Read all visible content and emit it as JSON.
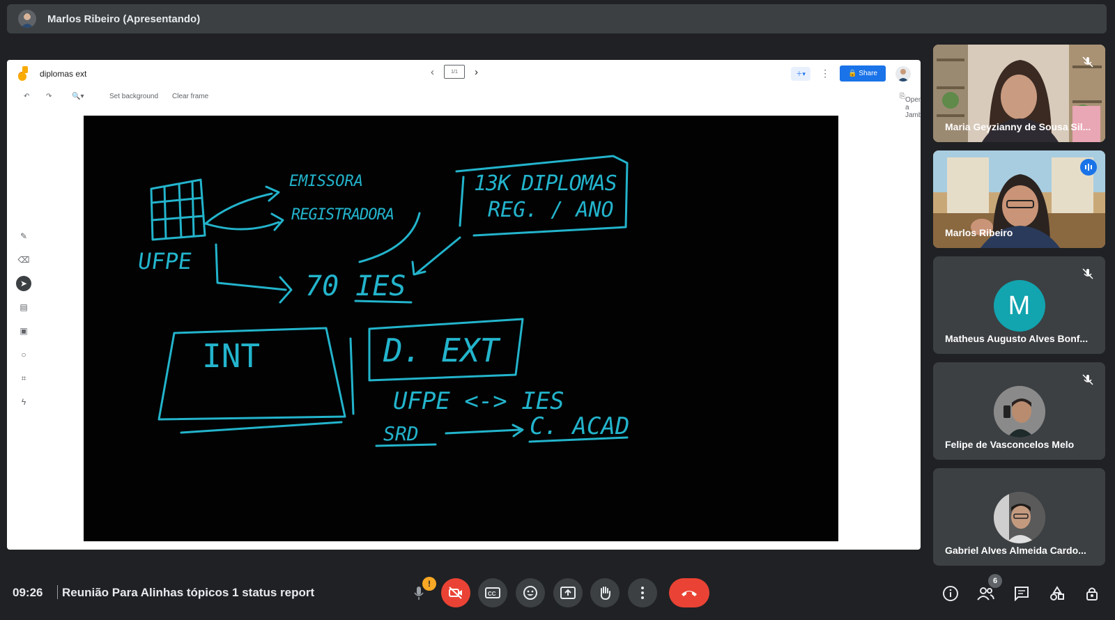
{
  "presenter": {
    "name": "Marlos Ribeiro (Apresentando)"
  },
  "jamboard": {
    "title": "diplomas ext",
    "frame_indicator": "1/1",
    "share_label": "Share",
    "toolbar": {
      "set_background": "Set background",
      "clear_frame": "Clear frame",
      "open_label": "Open on a Jamboard"
    },
    "accent": "#1a73e8"
  },
  "participants": [
    {
      "name": "Maria Geyzianny de Sousa Sil...",
      "muted": true,
      "type": "video"
    },
    {
      "name": "Marlos Ribeiro",
      "speaking": true,
      "type": "video"
    },
    {
      "name": "Matheus Augusto Alves Bonf...",
      "muted": true,
      "type": "initial",
      "initial": "M"
    },
    {
      "name": "Felipe de Vasconcelos Melo",
      "muted": true,
      "type": "photo"
    },
    {
      "name": "Gabriel Alves Almeida Cardo...",
      "muted": false,
      "type": "photo"
    }
  ],
  "meeting": {
    "time": "09:26",
    "title": "Reunião Para Alinhas tópicos 1 status report",
    "warning": "!",
    "participant_count": "6"
  },
  "whiteboard_text": {
    "ufpe": "UFPE",
    "emissora": "EMISSORA",
    "registradora": "REGISTRADORA",
    "box_line1": "13K DIPLOMAS",
    "box_line2": "REG. / ANO",
    "ies": "70 IES",
    "int": "INT",
    "dext": "D. EXT",
    "ufpe_ies": "UFPE <-> IES",
    "srd": "SRD",
    "cacad": "C. ACAD"
  },
  "colors": {
    "ink": "#23b4cc",
    "danger": "#ea4335",
    "speaking": "#8ab4f8"
  }
}
